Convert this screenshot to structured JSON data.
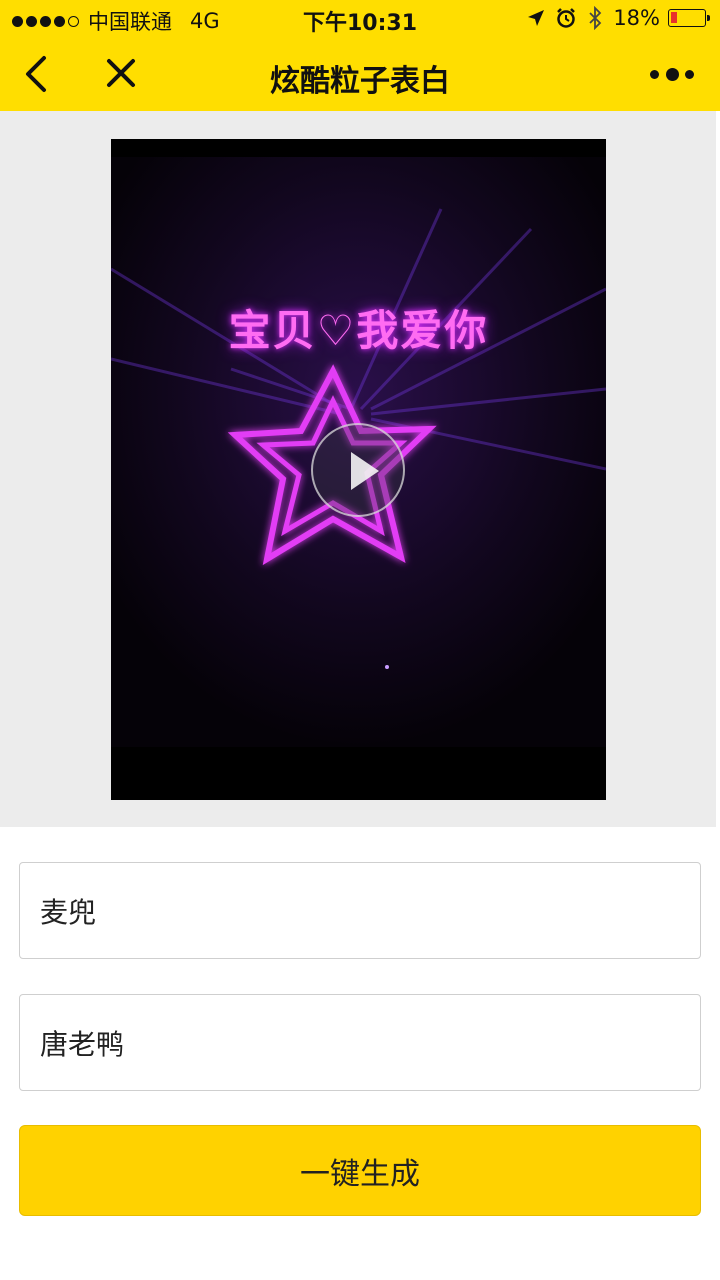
{
  "status_bar": {
    "carrier": "中国联通",
    "network": "4G",
    "time": "下午10:31",
    "battery": "18%",
    "battery_level": 0.18
  },
  "nav": {
    "title": "炫酷粒子表白",
    "icons": {
      "back": "chevron-left-icon",
      "close": "close-icon",
      "more": "more-dots-icon"
    }
  },
  "video": {
    "overlay_text": "宝贝♡我爱你",
    "play_icon": "play-icon"
  },
  "form": {
    "name1_value": "麦兜",
    "name2_value": "唐老鸭",
    "submit_label": "一键生成"
  },
  "colors": {
    "accent": "#ffde00",
    "button": "#ffd200",
    "neon": "#e23cf5"
  }
}
